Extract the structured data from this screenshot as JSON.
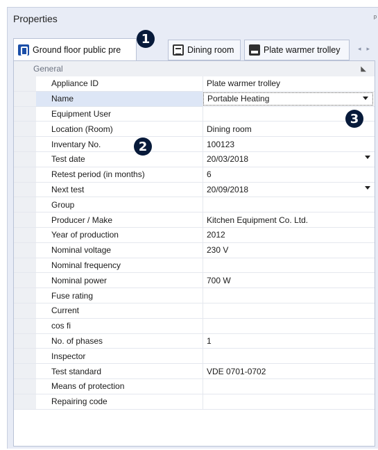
{
  "window": {
    "title": "Properties",
    "pin_glyph": "ᵖ"
  },
  "tabs": [
    {
      "label": "Ground floor public pre",
      "icon": "building-icon",
      "active": true
    },
    {
      "label": "Dining room",
      "icon": "document-icon",
      "active": false
    },
    {
      "label": "Plate warmer trolley",
      "icon": "trolley-icon",
      "active": false
    }
  ],
  "tab_scroll": {
    "left": "◂",
    "right": "▸"
  },
  "badges": {
    "one": "1",
    "two": "2",
    "three": "3"
  },
  "group": {
    "label": "General",
    "collapse_glyph": "◣"
  },
  "properties": [
    {
      "name": "Appliance ID",
      "value": "Plate warmer trolley",
      "dropdown": false
    },
    {
      "name": "Name",
      "value": "Portable Heating",
      "dropdown": true,
      "editing": true
    },
    {
      "name": "Equipment User",
      "value": "",
      "dropdown": false
    },
    {
      "name": "Location (Room)",
      "value": "Dining room",
      "dropdown": false
    },
    {
      "name": "Inventary No.",
      "value": "100123",
      "dropdown": false
    },
    {
      "name": "Test date",
      "value": "20/03/2018",
      "dropdown": true
    },
    {
      "name": "Retest period (in months)",
      "value": "6",
      "dropdown": false
    },
    {
      "name": "Next test",
      "value": "20/09/2018",
      "dropdown": true
    },
    {
      "name": "Group",
      "value": "",
      "dropdown": false
    },
    {
      "name": "Producer / Make",
      "value": "Kitchen Equipment Co. Ltd.",
      "dropdown": false
    },
    {
      "name": "Year of production",
      "value": "2012",
      "dropdown": false
    },
    {
      "name": "Nominal voltage",
      "value": "230 V",
      "dropdown": false
    },
    {
      "name": "Nominal frequency",
      "value": "",
      "dropdown": false
    },
    {
      "name": "Nominal power",
      "value": "700 W",
      "dropdown": false
    },
    {
      "name": "Fuse rating",
      "value": "",
      "dropdown": false
    },
    {
      "name": "Current",
      "value": "",
      "dropdown": false
    },
    {
      "name": "cos fi",
      "value": "",
      "dropdown": false
    },
    {
      "name": "No. of phases",
      "value": "1",
      "dropdown": false
    },
    {
      "name": "Inspector",
      "value": "",
      "dropdown": false
    },
    {
      "name": "Test standard",
      "value": "VDE 0701-0702",
      "dropdown": false
    },
    {
      "name": "Means of protection",
      "value": "",
      "dropdown": false
    },
    {
      "name": "Repairing code",
      "value": "",
      "dropdown": false
    }
  ],
  "colors": {
    "panel_bg": "#e8ecf6",
    "badge_bg": "#071a3a",
    "selected_row": "#dde6f6"
  }
}
